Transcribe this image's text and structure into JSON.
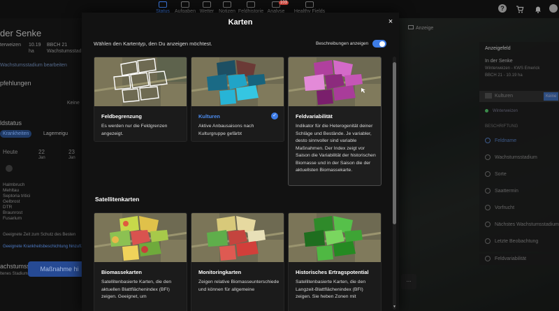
{
  "nav": {
    "items": [
      {
        "label": "Status",
        "active": true
      },
      {
        "label": "Aufgaben"
      },
      {
        "label": "Wetter"
      },
      {
        "label": "Notizen"
      },
      {
        "label": "Feldhistorie"
      },
      {
        "label": "Analyse",
        "badge": "103"
      },
      {
        "label": "Healthy Fields"
      }
    ],
    "help_icon": "?",
    "icons": [
      "help-icon",
      "cart-icon",
      "bell-icon",
      "profile-icon"
    ]
  },
  "left_panel": {
    "title": "der Senke",
    "row1": [
      "terweizen",
      "10.19",
      "BBCH 21"
    ],
    "row1_sub": [
      "",
      "ha",
      "Wachstumsstadium"
    ],
    "tag": "Wachstumsstadium bearbeiten",
    "empfehlungen": "pfehlungen",
    "keine": "Keine",
    "feldstatus": "ldstatus",
    "tab1": "Krankheiten",
    "tab2": "Lagerneigu",
    "days": [
      "Heute",
      "22",
      "23"
    ],
    "day_sub": [
      "",
      "Jan",
      "Jan"
    ],
    "diseases": [
      "Halmbruch",
      "Mehltau",
      "Septoria tritici",
      "Gelbrost",
      "DTR",
      "Braunrost",
      "Fusarium"
    ],
    "note": "Geeignete Zeit zum Schutz des Besten",
    "link": "Geeignete Krankheitsbeschichtung hinzufügen →",
    "wachstum": "achstumsstadium",
    "wachstum_sub": "ltenes Stadium",
    "button": "Maßnahme hi"
  },
  "map_panel": {
    "anzeige_btn": "Anzeige",
    "header": "Anzeigefeld",
    "field_name": "In der Senke",
    "field_meta": "Winterweizen - KWS Emerick",
    "field_meta2": "BBCH 21 - 10.19 ha",
    "kulturen": "Kulturen",
    "keine_btn": "Keine",
    "legend": "Winterweizen",
    "beschriftung": "BESCHRIFTUNG",
    "options": [
      "Feldname",
      "Wachstumsstadium",
      "Sorte",
      "Saattermin",
      "Vorfrucht",
      "Nächstes Wachstumsstadium",
      "Letzte Beobachtung",
      "Feldvariabilität"
    ],
    "map_btn": "..."
  },
  "modal": {
    "title": "Karten",
    "close": "×",
    "instruction": "Wählen den Kartentyp, den Du anzeigen möchtest.",
    "toggle_label": "Beschreibungen anzeigen",
    "toggle_on": true,
    "section_satellite": "Satellitenkarten",
    "cards": [
      {
        "title": "Feldbegrenzung",
        "desc": "Es werden nur die Feldgrenzen angezeigt.",
        "selected": false
      },
      {
        "title": "Kulturen",
        "desc": "Aktive Anbausaisons nach Kulturgruppe gefärbt",
        "selected": true
      },
      {
        "title": "Feldvariabilität",
        "desc": "Indikator für die Heterogenität deiner Schläge und Bestände. Je variabler, desto sinnvoller sind variable Maßnahmen. Der Index zeigt vor Saison die Variabilität der historischen Biomasse und in der Saison die der aktuellsten Biomassekarte.",
        "selected": false
      },
      {
        "title": "Biomassekarten",
        "desc": "Satellitenbasierte Karten, die den aktuellen Blattflächenindex (BFI) zeigen. Geeignet, um",
        "selected": false
      },
      {
        "title": "Monitoringkarten",
        "desc": "Zeigen relative Biomasseunterschiede und können für allgemeine",
        "selected": false
      },
      {
        "title": "Historisches Ertragspotential",
        "desc": "Satellitenbasierte Karten, die den Langzeit-Blattflächenindex (BFI) zeigen. Sie heben Zonen mit",
        "selected": false
      }
    ],
    "colors": {
      "accent": "#3d7ce6",
      "kulturen": "#2aa0c4",
      "variabilitaet": "#c04fb0"
    }
  }
}
